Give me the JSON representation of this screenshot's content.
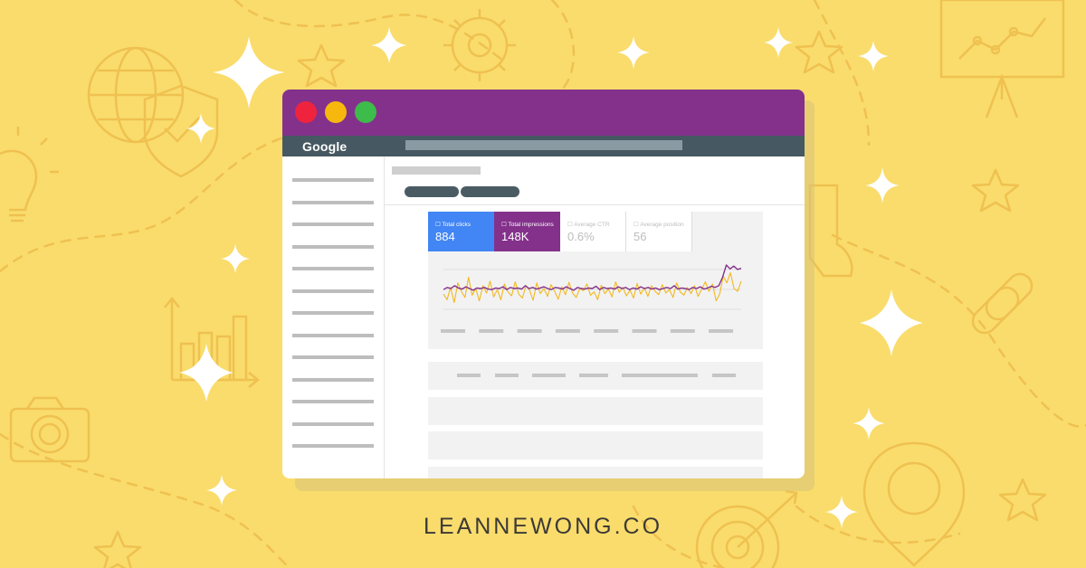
{
  "window": {
    "brand": "Google"
  },
  "metrics": [
    {
      "label": "Total clicks",
      "value": "884",
      "active": true,
      "color": "#4285f4"
    },
    {
      "label": "Total impressions",
      "value": "148K",
      "active": true,
      "color": "#84318b"
    },
    {
      "label": "Average CTR",
      "value": "0.6%",
      "active": false
    },
    {
      "label": "Average position",
      "value": "56",
      "active": false
    }
  ],
  "chart_data": {
    "type": "line",
    "series": [
      {
        "color": "#84318b",
        "values": [
          48,
          52,
          50,
          55,
          51,
          49,
          53,
          50,
          47,
          51,
          50,
          52,
          49,
          48,
          51,
          50,
          53,
          48,
          52,
          50,
          51,
          49,
          55,
          50,
          52,
          49,
          51,
          53,
          50,
          48,
          52,
          51,
          49,
          53,
          50,
          47,
          52,
          50,
          49,
          51,
          50,
          54,
          48,
          52,
          50,
          51,
          49,
          53,
          50,
          52,
          48,
          51,
          49,
          53,
          50,
          52,
          49,
          51,
          48,
          50,
          52,
          50,
          55,
          49,
          51,
          50,
          48,
          52,
          50,
          53,
          49,
          51,
          54,
          52,
          55,
          70,
          92,
          85,
          90,
          84,
          86
        ]
      },
      {
        "color": "#f2b81f",
        "values": [
          40,
          30,
          52,
          25,
          60,
          45,
          34,
          70,
          38,
          50,
          28,
          55,
          42,
          63,
          35,
          48,
          30,
          58,
          44,
          37,
          62,
          40,
          33,
          55,
          47,
          29,
          60,
          41,
          50,
          36,
          57,
          45,
          31,
          53,
          39,
          61,
          42,
          34,
          50,
          46,
          58,
          38,
          44,
          30,
          56,
          41,
          49,
          35,
          62,
          43,
          52,
          37,
          47,
          33,
          59,
          40,
          51,
          36,
          55,
          45,
          39,
          57,
          42,
          48,
          34,
          60,
          44,
          38,
          52,
          41,
          55,
          36,
          49,
          62,
          45,
          58,
          28,
          40,
          72,
          60,
          78,
          50,
          45,
          63
        ]
      }
    ],
    "grid": true,
    "legend": "none"
  },
  "footer": {
    "site": "LEANNEWONG.CO"
  }
}
